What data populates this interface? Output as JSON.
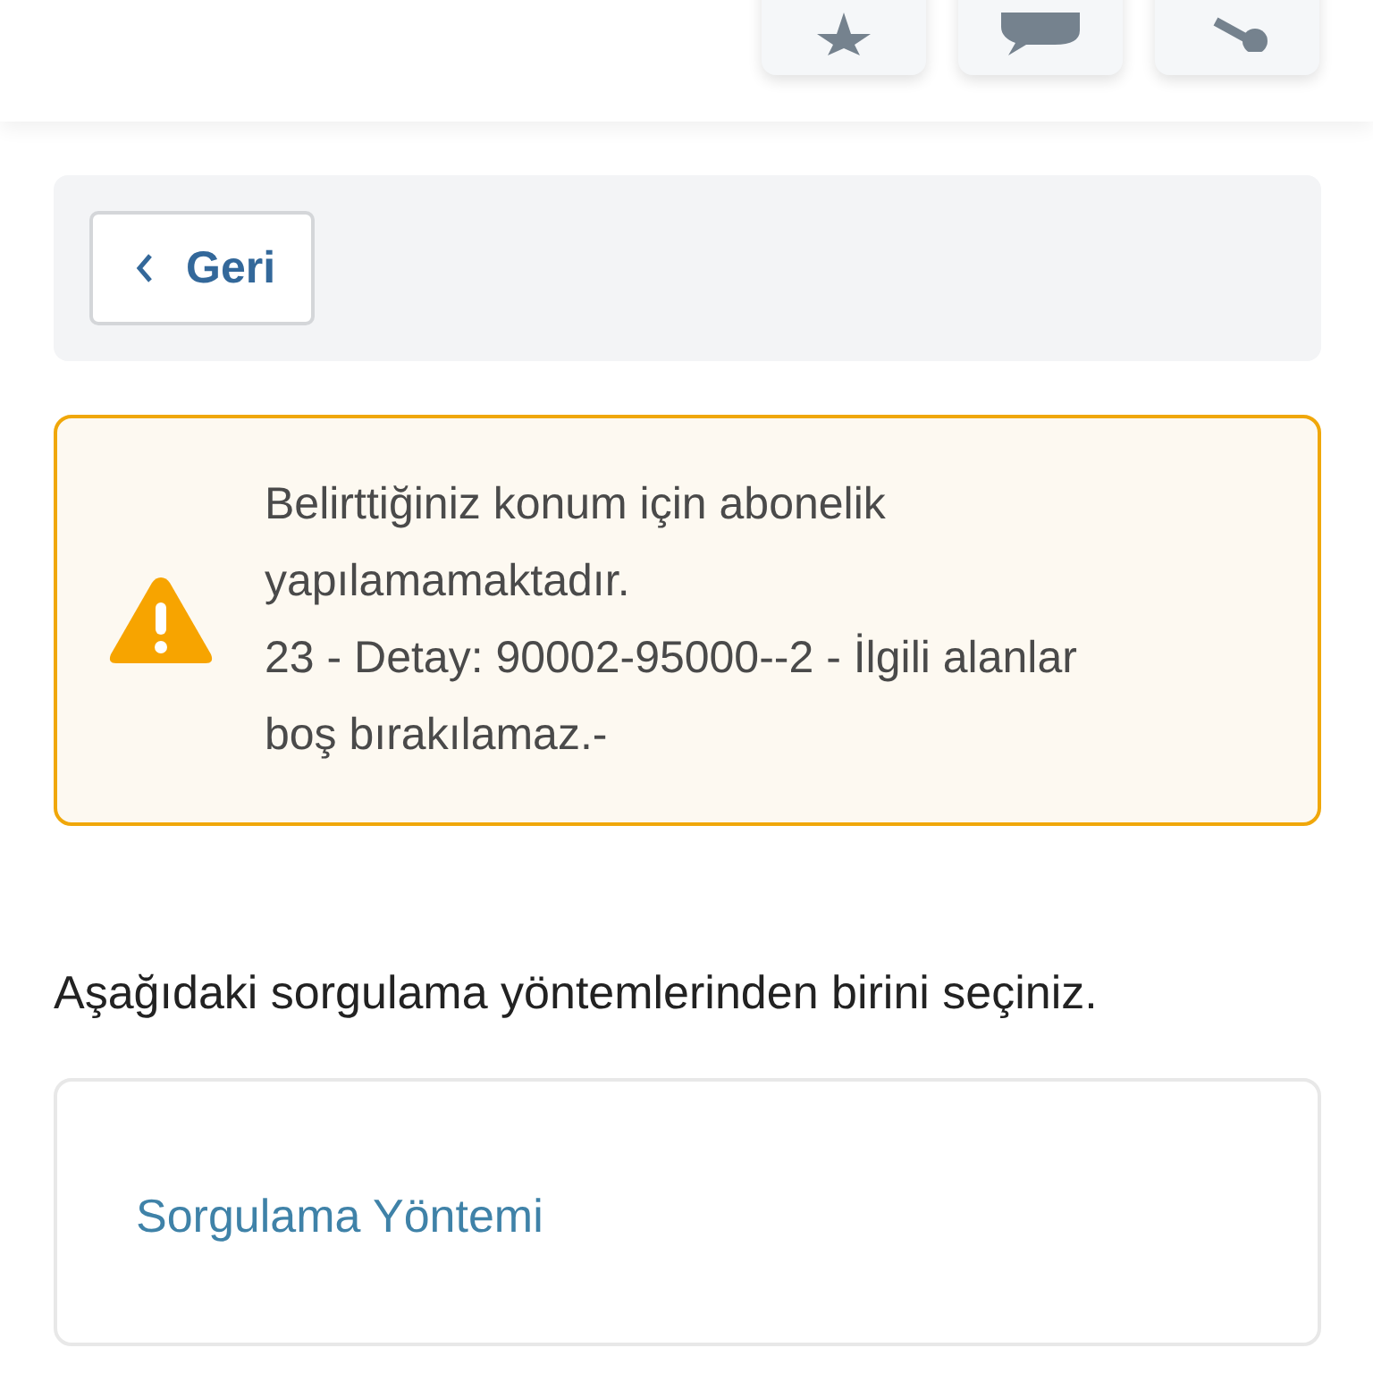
{
  "header": {
    "actions": [
      {
        "kind": "star"
      },
      {
        "kind": "comment"
      },
      {
        "kind": "share"
      }
    ]
  },
  "back_button": {
    "label": "Geri"
  },
  "warning": {
    "message": "Belirttiğiniz konum için abonelik yapılamamaktadır.",
    "detail": "23 - Detay: 90002-95000--2 - İlgili alanlar boş bırakılamaz.-"
  },
  "instruction": "Aşağıdaki sorgulama yöntemlerinden birini seçiniz.",
  "method_card": {
    "title": "Sorgulama Yöntemi"
  }
}
